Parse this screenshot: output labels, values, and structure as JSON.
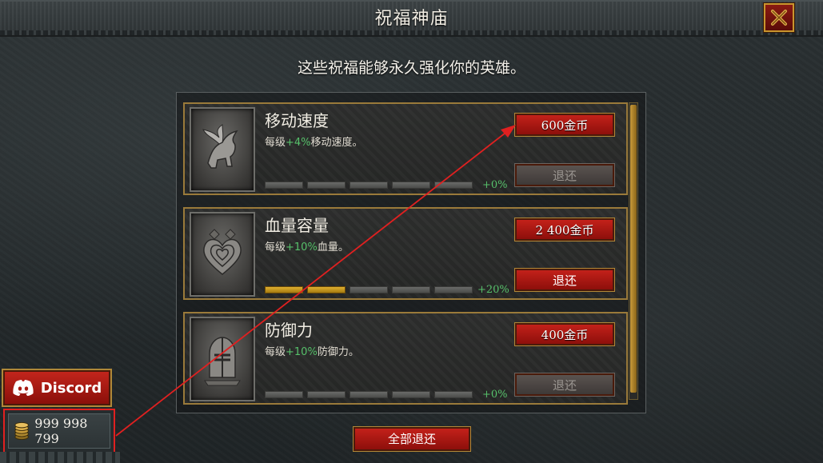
{
  "header": {
    "title": "祝福神庙",
    "close_icon": "close-x-icon"
  },
  "subtitle": "这些祝福能够永久强化你的英雄。",
  "blessings": [
    {
      "name": "移动速度",
      "desc_prefix": "每级",
      "desc_bonus": "+4%",
      "desc_suffix": "移动速度。",
      "icon": "pegasus-icon",
      "levels_filled": 0,
      "levels_total": 5,
      "current_bonus": "+0%",
      "buy_label": "600金币",
      "refund_label": "退还",
      "refund_enabled": false
    },
    {
      "name": "血量容量",
      "desc_prefix": "每级",
      "desc_bonus": "+10%",
      "desc_suffix": "血量。",
      "icon": "heart-icon",
      "levels_filled": 2,
      "levels_total": 5,
      "current_bonus": "+20%",
      "buy_label": "2 400金币",
      "refund_label": "退还",
      "refund_enabled": true
    },
    {
      "name": "防御力",
      "desc_prefix": "每级",
      "desc_bonus": "+10%",
      "desc_suffix": "防御力。",
      "icon": "knight-helmet-icon",
      "levels_filled": 0,
      "levels_total": 5,
      "current_bonus": "+0%",
      "buy_label": "400金币",
      "refund_label": "退还",
      "refund_enabled": false
    }
  ],
  "refund_all_label": "全部退还",
  "discord_label": "Discord",
  "gold": {
    "amount": "999 998 799",
    "icon": "coin-stack-icon"
  },
  "colors": {
    "accent_red": "#c3211a",
    "gold_border": "#b08838",
    "bonus_green": "#56c06a",
    "level_fill": "#e0b030",
    "annotation_red": "#e02020"
  }
}
